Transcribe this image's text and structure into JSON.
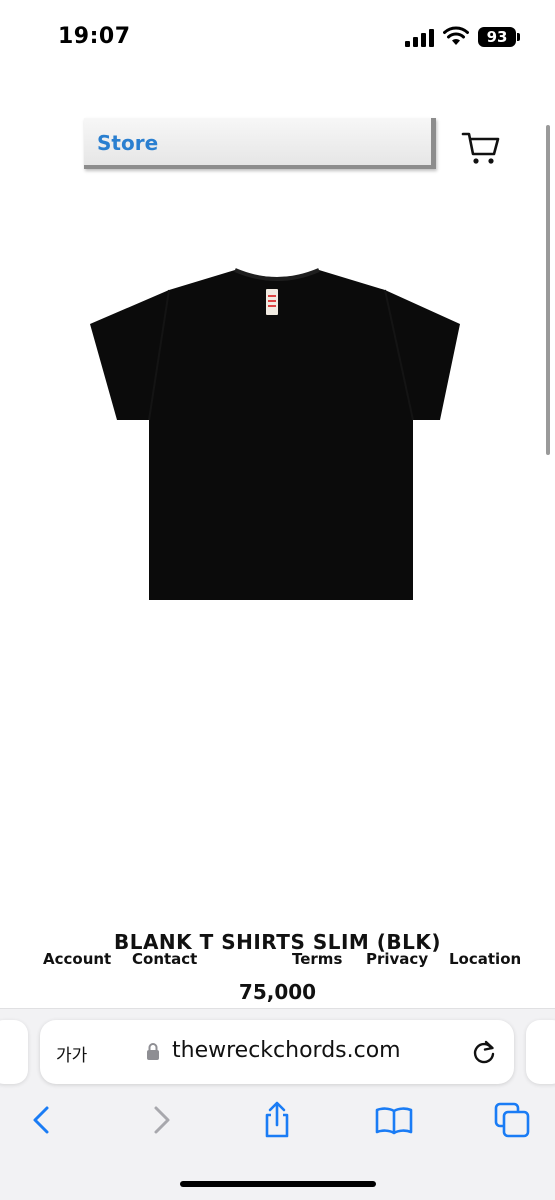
{
  "status_bar": {
    "time": "19:07",
    "battery": "93",
    "icons": [
      "signal-icon",
      "wifi-icon",
      "battery-icon"
    ]
  },
  "header": {
    "store_label": "Store",
    "cart_icon": "cart-icon"
  },
  "product": {
    "image_icon": "black-tshirt-image",
    "title": "BLANK T SHIRTS SLIM (BLK)",
    "price": "75,000"
  },
  "footer_links": {
    "account": "Account",
    "contact": "Contact",
    "terms": "Terms",
    "privacy": "Privacy",
    "location": "Location"
  },
  "browser": {
    "text_size_label": "가가",
    "url": "thewreckchords.com",
    "toolbar_icons": [
      "back-icon",
      "forward-icon",
      "share-icon",
      "bookmarks-icon",
      "tabs-icon"
    ]
  },
  "colors": {
    "accent": "#2a7fd0",
    "safari_blue": "#1a7cf5",
    "disabled": "#a8a8ad"
  }
}
